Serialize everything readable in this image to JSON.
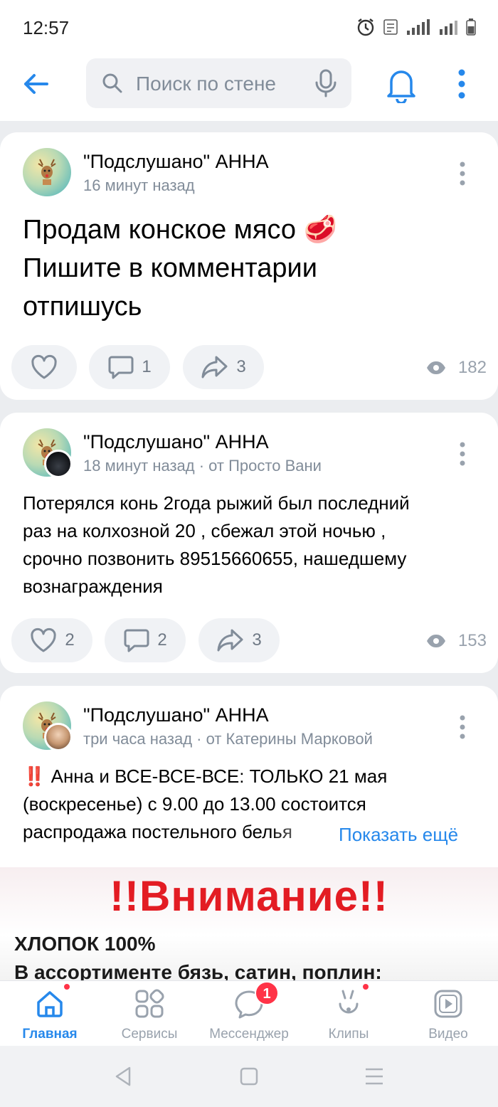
{
  "status": {
    "time": "12:57"
  },
  "search": {
    "placeholder": "Поиск по стене"
  },
  "posts": [
    {
      "author": "\"Подслушано\" АННА",
      "time": "16 минут назад",
      "text_lines": [
        "Продам конское мясо 🥩",
        "Пишите в комментарии",
        "отпишусь"
      ],
      "likes": "",
      "comments": "1",
      "shares": "3",
      "views": "182"
    },
    {
      "author": "\"Подслушано\" АННА",
      "time": "18 минут назад · от Просто Вани",
      "text_lines": [
        "Потерялся конь 2года рыжий был последний",
        "раз на колхозной 20 , сбежал этой ночью ,",
        "срочно позвонить 89515660655, нашедшему",
        "вознаграждения"
      ],
      "likes": "2",
      "comments": "2",
      "shares": "3",
      "views": "153"
    },
    {
      "author": "\"Подслушано\" АННА",
      "time": "три часа назад · от Катерины Марковой",
      "text_lines": [
        "‼️ Анна и ВСЕ-ВСЕ-ВСЕ: ТОЛЬКО 21 мая",
        "(воскресенье) с 9.00 до 13.00 состоится",
        "распродажа постельного белья"
      ],
      "show_more": "Показать ещё",
      "image_text": {
        "title": "!!Внимание!!",
        "line1": "ХЛОПОК 100%",
        "line2": "В ассортименте бязь, сатин, поплин:"
      }
    }
  ],
  "tabs": [
    {
      "label": "Главная",
      "icon": "home-icon",
      "active": true
    },
    {
      "label": "Сервисы",
      "icon": "services-icon"
    },
    {
      "label": "Мессенджер",
      "icon": "messenger-icon",
      "badge": "1"
    },
    {
      "label": "Клипы",
      "icon": "clips-icon"
    },
    {
      "label": "Видео",
      "icon": "video-icon"
    }
  ],
  "colors": {
    "accent": "#2688eb",
    "badge": "#ff3347",
    "secondary_text": "#818c99"
  }
}
